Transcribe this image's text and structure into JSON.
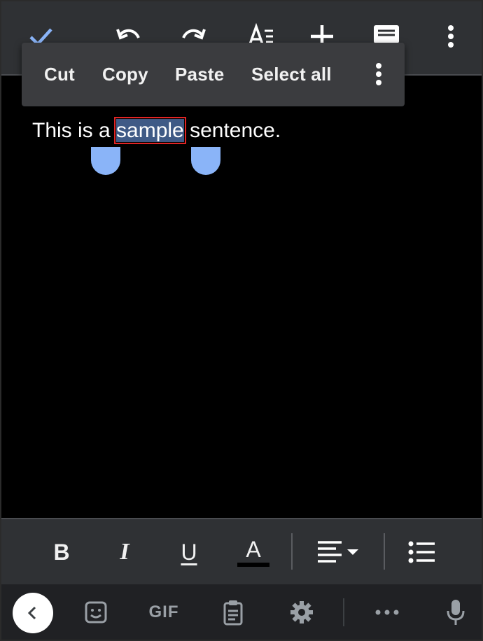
{
  "toolbar": {
    "icons": [
      "checkmark-icon",
      "undo-icon",
      "redo-icon",
      "text-format-icon",
      "insert-plus-icon",
      "comment-icon",
      "more-vert-icon"
    ]
  },
  "context_menu": {
    "items": [
      {
        "label": "Cut"
      },
      {
        "label": "Copy"
      },
      {
        "label": "Paste"
      },
      {
        "label": "Select all"
      }
    ]
  },
  "document": {
    "before": "This is a ",
    "selected": "sample",
    "after": " sentence."
  },
  "format_bar": {
    "bold": "B",
    "italic": "I",
    "underline": "U",
    "text_color": "A"
  },
  "keyboard": {
    "gif": "GIF"
  },
  "colors": {
    "accent": "#8ab4f8",
    "selection": "#3f5a86",
    "highlight_box": "#e02424",
    "toolbar_bg": "#2f3134"
  }
}
